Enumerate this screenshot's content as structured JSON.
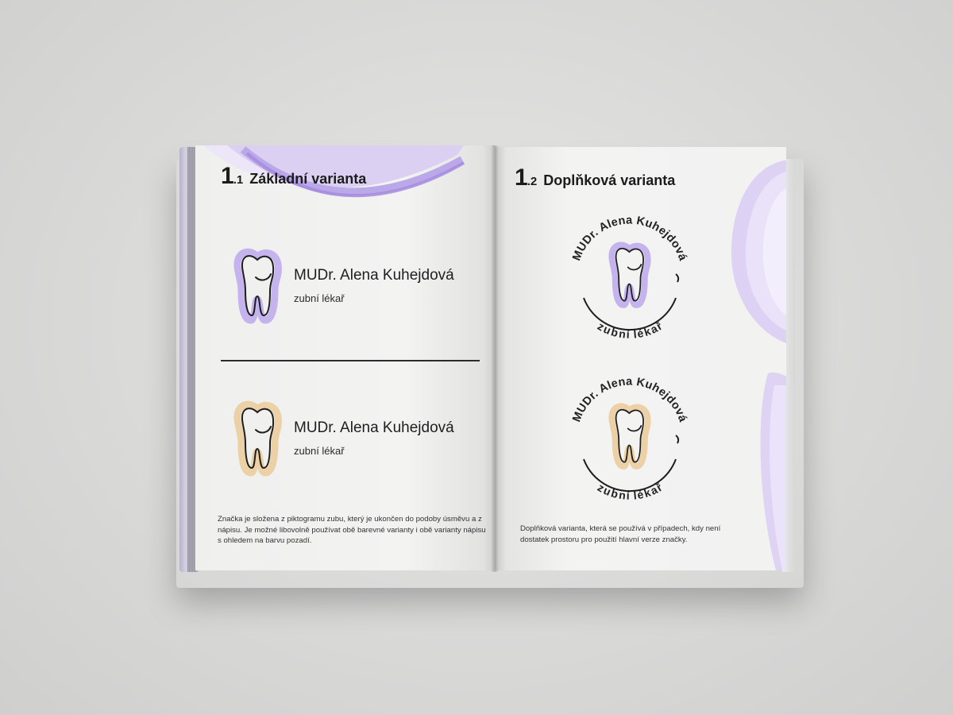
{
  "colors": {
    "purple": "#b9a6e6",
    "purple_light": "#ddd3f3",
    "beige": "#e8c89b",
    "ink": "#1e1e1e"
  },
  "left_page": {
    "section_number": "1",
    "section_sub": ".1",
    "section_title": "Základní varianta",
    "logo_1": {
      "name": "MUDr. Alena Kuhejdová",
      "profession": "zubní lékař",
      "icon": "tooth-icon",
      "color": "purple"
    },
    "logo_2": {
      "name": "MUDr. Alena Kuhejdová",
      "profession": "zubní lékař",
      "icon": "tooth-icon",
      "color": "beige"
    },
    "description": "Značka je složena z piktogramu zubu, který je ukončen do podoby úsměvu a z nápisu. Je možné libovolně používat obě barevné varianty i obě varianty nápisu s ohledem na barvu pozadí."
  },
  "right_page": {
    "section_number": "1",
    "section_sub": ".2",
    "section_title": "Doplňková varianta",
    "badge_1": {
      "arc_top": "MUDr. Alena Kuhejdová",
      "arc_bottom": "zubní lékař",
      "icon": "tooth-icon",
      "color": "purple"
    },
    "badge_2": {
      "arc_top": "MUDr. Alena Kuhejdová",
      "arc_bottom": "zubní lékař",
      "icon": "tooth-icon",
      "color": "beige"
    },
    "description": "Doplňková varianta, která se používá v případech, kdy není dostatek prostoru pro použití hlavní verze značky."
  }
}
